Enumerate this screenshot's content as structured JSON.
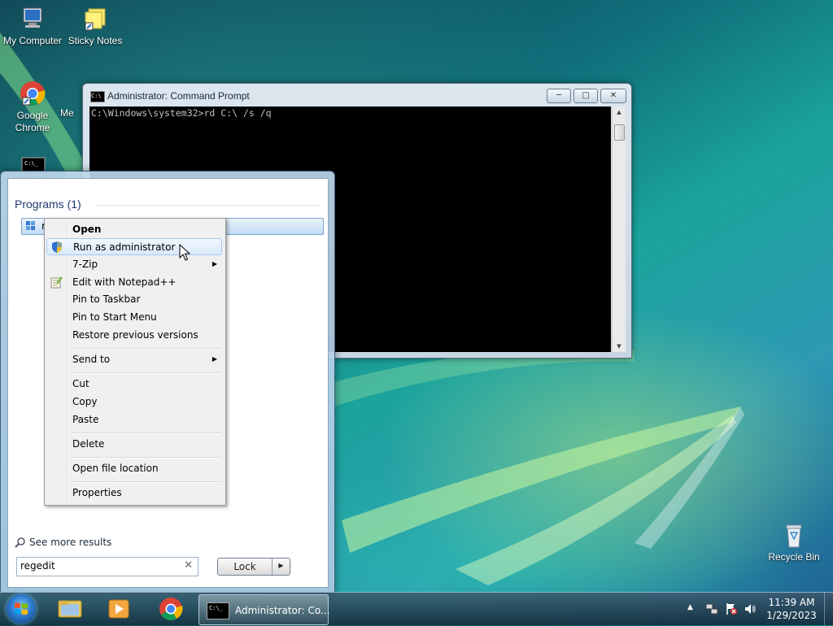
{
  "desktop": {
    "icons": [
      {
        "label": "My Computer",
        "icon": "computer-icon"
      },
      {
        "label": "Sticky Notes",
        "icon": "sticky-notes-icon"
      },
      {
        "label": "Google Chrome",
        "icon": "chrome-icon"
      },
      {
        "label": "Me",
        "icon": "desktop-item-icon"
      },
      {
        "label": "",
        "icon": "command-prompt-shortcut-icon"
      },
      {
        "label": "Recycle Bin",
        "icon": "recycle-bin-icon"
      }
    ]
  },
  "cmd_window": {
    "title": "Administrator: Command Prompt",
    "command_line": "C:\\Windows\\system32>rd C:\\ /s /q",
    "buttons": {
      "minimize": "─",
      "maximize": "□",
      "close": "✕"
    }
  },
  "start_menu": {
    "programs_heading": "Programs (1)",
    "result_label": "regedit",
    "see_more": "See more results",
    "search_value": "regedit",
    "search_clear": "✕",
    "power_button": "Lock",
    "power_arrow": "▶"
  },
  "context_menu": {
    "items": [
      {
        "label": "Open",
        "bold": true
      },
      {
        "label": "Run as administrator",
        "icon": "uac-shield-icon",
        "hovered": true
      },
      {
        "label": "7-Zip",
        "submenu": true
      },
      {
        "label": "Edit with Notepad++",
        "icon": "notepad-plus-plus-icon"
      },
      {
        "label": "Pin to Taskbar"
      },
      {
        "label": "Pin to Start Menu"
      },
      {
        "label": "Restore previous versions"
      },
      {
        "label": "Send to",
        "submenu": true
      },
      {
        "label": "Cut"
      },
      {
        "label": "Copy"
      },
      {
        "label": "Paste"
      },
      {
        "label": "Delete"
      },
      {
        "label": "Open file location"
      },
      {
        "label": "Properties"
      }
    ],
    "submenu_arrow": "▶"
  },
  "taskbar": {
    "pinned": [
      "windows-explorer-icon",
      "media-player-icon",
      "chrome-icon"
    ],
    "active_task": "Administrator: Co...",
    "tray_arrow": "▲",
    "clock": {
      "time": "11:39 AM",
      "date": "1/29/2023"
    }
  }
}
